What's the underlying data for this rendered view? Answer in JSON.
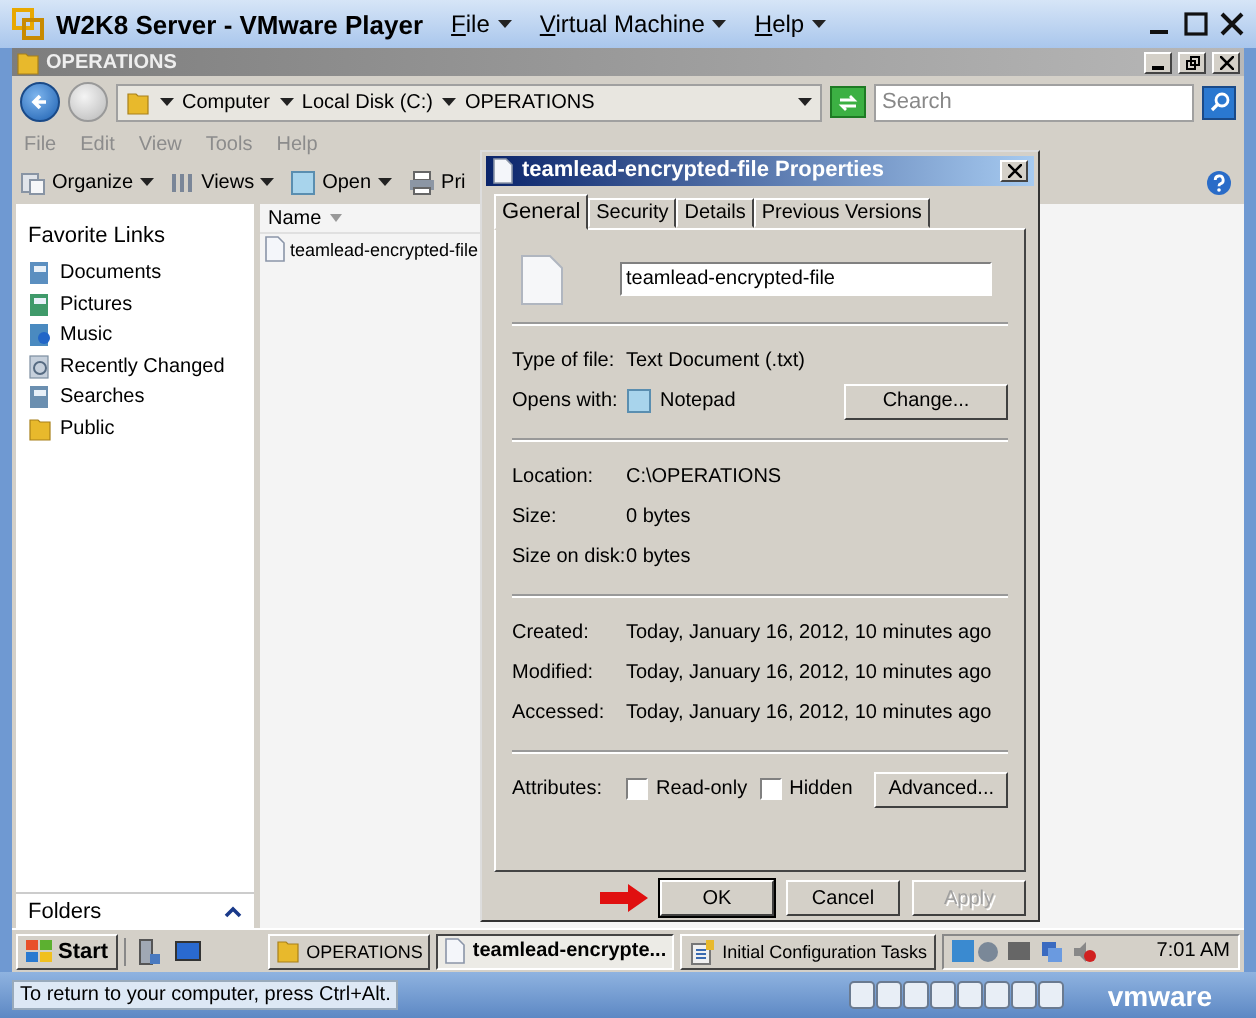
{
  "vmware": {
    "title": "W2K8 Server - VMware Player",
    "menus": [
      "File",
      "Virtual Machine",
      "Help"
    ]
  },
  "explorer": {
    "title": "OPERATIONS",
    "breadcrumb": [
      "Computer",
      "Local Disk (C:)",
      "OPERATIONS"
    ],
    "search": {
      "placeholder": "Search"
    },
    "menu": [
      {
        "label": "File",
        "disabled": true
      },
      {
        "label": "Edit",
        "disabled": true
      },
      {
        "label": "View",
        "disabled": true
      },
      {
        "label": "Tools",
        "disabled": true
      },
      {
        "label": "Help",
        "disabled": true
      }
    ],
    "toolbar": [
      "Organize",
      "Views",
      "Open",
      "Pri"
    ],
    "favorite_links": {
      "title": "Favorite Links",
      "items": [
        "Documents",
        "Pictures",
        "Music",
        "Recently Changed",
        "Searches",
        "Public"
      ]
    },
    "folders": "Folders",
    "file_list": {
      "columns": [
        "Name"
      ],
      "files": [
        "teamlead-encrypted-file"
      ]
    }
  },
  "dialog": {
    "title": "teamlead-encrypted-file Properties",
    "tabs": [
      {
        "label": "General",
        "selected": true
      },
      {
        "label": "Security",
        "selected": false
      },
      {
        "label": "Details",
        "selected": false
      },
      {
        "label": "Previous Versions",
        "selected": false
      }
    ],
    "name": "teamlead-encrypted-file",
    "type_of_file": {
      "label": "Type of file:",
      "value": "Text Document (.txt)"
    },
    "opens_with": {
      "label": "Opens with:",
      "value": "Notepad",
      "button": "Change..."
    },
    "location_rows": [
      {
        "label": "Location:",
        "value": "C:\\OPERATIONS"
      },
      {
        "label": "Size:",
        "value": "0 bytes"
      },
      {
        "label": "Size on disk:",
        "value": "0 bytes"
      }
    ],
    "date_rows": [
      {
        "label": "Created:",
        "value": "Today, January 16, 2012, 10 minutes ago"
      },
      {
        "label": "Modified:",
        "value": "Today, January 16, 2012, 10 minutes ago"
      },
      {
        "label": "Accessed:",
        "value": "Today, January 16, 2012, 10 minutes ago"
      }
    ],
    "attributes": {
      "label": "Attributes:",
      "options": [
        {
          "label": "Read-only",
          "checked": false
        },
        {
          "label": "Hidden",
          "checked": false
        }
      ],
      "button": "Advanced..."
    },
    "buttons": [
      {
        "label": "OK",
        "default": true,
        "disabled": false
      },
      {
        "label": "Cancel",
        "default": false,
        "disabled": false
      },
      {
        "label": "Apply",
        "default": false,
        "disabled": true
      }
    ]
  },
  "taskbar": {
    "start": "Start",
    "tasks": [
      {
        "label": "OPERATIONS",
        "selected": false
      },
      {
        "label": "teamlead-encrypte...",
        "selected": true
      },
      {
        "label": "Initial Configuration Tasks",
        "selected": false
      }
    ],
    "clock": "7:01 AM"
  },
  "status_bar": {
    "hint": "To return to your computer, press Ctrl+Alt.",
    "logo": "vmware"
  }
}
